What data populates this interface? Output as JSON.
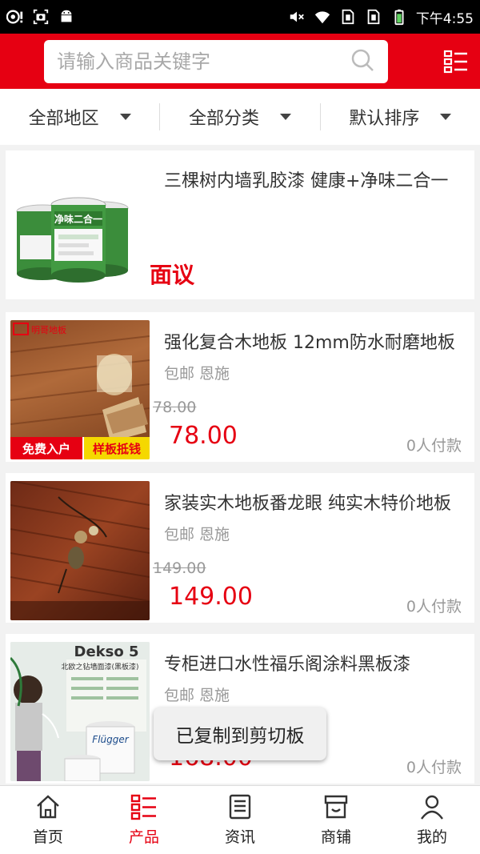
{
  "statusbar": {
    "time": "下午4:55",
    "icons": [
      "usb-debug-icon",
      "screenshot-icon",
      "android-icon",
      "mute-icon",
      "wifi-icon",
      "sim1-icon",
      "sim2-icon",
      "battery-icon"
    ]
  },
  "header": {
    "search_placeholder": "请输入商品关键字",
    "accent": "#e60012"
  },
  "filters": [
    {
      "label": "全部地区"
    },
    {
      "label": "全部分类"
    },
    {
      "label": "默认排序"
    }
  ],
  "products": [
    {
      "title": "三棵树内墙乳胶漆 健康+净味二合一",
      "negotiable": "面议"
    },
    {
      "title": "强化复合木地板 12mm防水耐磨地板",
      "sub": "包邮 恩施",
      "price_old": "78.00",
      "price": "78.00",
      "sold": "0人付款",
      "badge_left": "免费入户",
      "badge_right": "样板抵钱",
      "brand": "明哥地板"
    },
    {
      "title": "家装实木地板番龙眼 纯实木特价地板",
      "sub": "包邮 恩施",
      "price_old": "149.00",
      "price": "149.00",
      "sold": "0人付款"
    },
    {
      "title": "专柜进口水性福乐阁涂料黑板漆",
      "sub": "包邮 恩施",
      "price": "168.00",
      "sold": "0人付款",
      "img_brand": "Dekso 5",
      "img_sub": "北欧之钻墙面漆(黑板漆)",
      "img_can": "Flügger"
    }
  ],
  "toast": "已复制到剪切板",
  "tabs": [
    {
      "label": "首页",
      "icon": "home-icon"
    },
    {
      "label": "产品",
      "icon": "list-icon",
      "active": true
    },
    {
      "label": "资讯",
      "icon": "news-icon"
    },
    {
      "label": "商铺",
      "icon": "store-icon"
    },
    {
      "label": "我的",
      "icon": "user-icon"
    }
  ]
}
